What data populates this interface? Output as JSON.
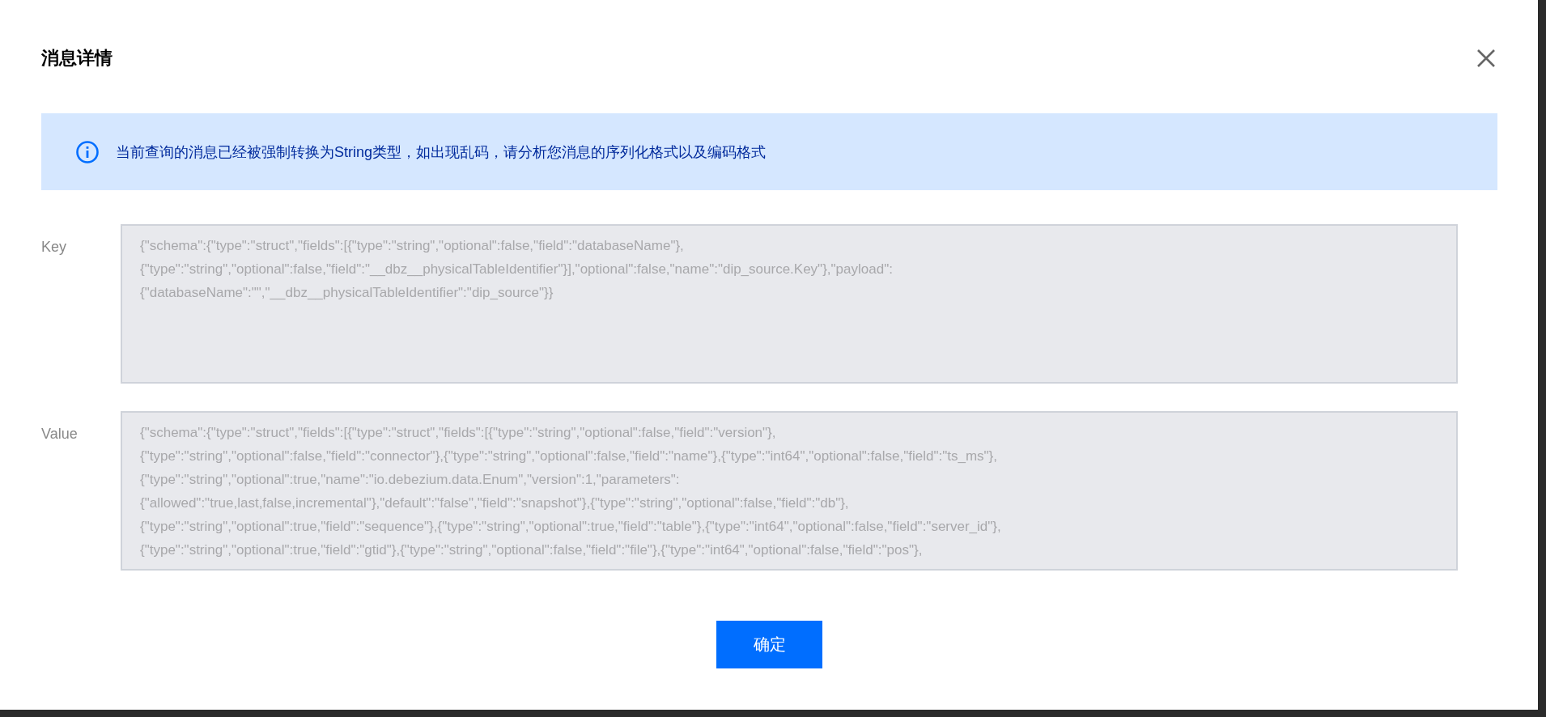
{
  "dialog": {
    "title": "消息详情",
    "alert": "当前查询的消息已经被强制转换为String类型，如出现乱码，请分析您消息的序列化格式以及编码格式",
    "fields": [
      {
        "label": "Key",
        "value": [
          "{\"schema\":{\"type\":\"struct\",\"fields\":[{\"type\":\"string\",\"optional\":false,\"field\":\"databaseName\"},",
          "{\"type\":\"string\",\"optional\":false,\"field\":\"__dbz__physicalTableIdentifier\"}],\"optional\":false,\"name\":\"dip_source.Key\"},\"payload\":",
          "{\"databaseName\":\"\",\"__dbz__physicalTableIdentifier\":\"dip_source\"}}"
        ]
      },
      {
        "label": "Value",
        "value": [
          "{\"schema\":{\"type\":\"struct\",\"fields\":[{\"type\":\"struct\",\"fields\":[{\"type\":\"string\",\"optional\":false,\"field\":\"version\"},",
          "{\"type\":\"string\",\"optional\":false,\"field\":\"connector\"},{\"type\":\"string\",\"optional\":false,\"field\":\"name\"},{\"type\":\"int64\",\"optional\":false,\"field\":\"ts_ms\"},",
          "{\"type\":\"string\",\"optional\":true,\"name\":\"io.debezium.data.Enum\",\"version\":1,\"parameters\":",
          "{\"allowed\":\"true,last,false,incremental\"},\"default\":\"false\",\"field\":\"snapshot\"},{\"type\":\"string\",\"optional\":false,\"field\":\"db\"},",
          "{\"type\":\"string\",\"optional\":true,\"field\":\"sequence\"},{\"type\":\"string\",\"optional\":true,\"field\":\"table\"},{\"type\":\"int64\",\"optional\":false,\"field\":\"server_id\"},",
          "{\"type\":\"string\",\"optional\":true,\"field\":\"gtid\"},{\"type\":\"string\",\"optional\":false,\"field\":\"file\"},{\"type\":\"int64\",\"optional\":false,\"field\":\"pos\"},"
        ]
      }
    ],
    "confirm_button": "确定"
  }
}
